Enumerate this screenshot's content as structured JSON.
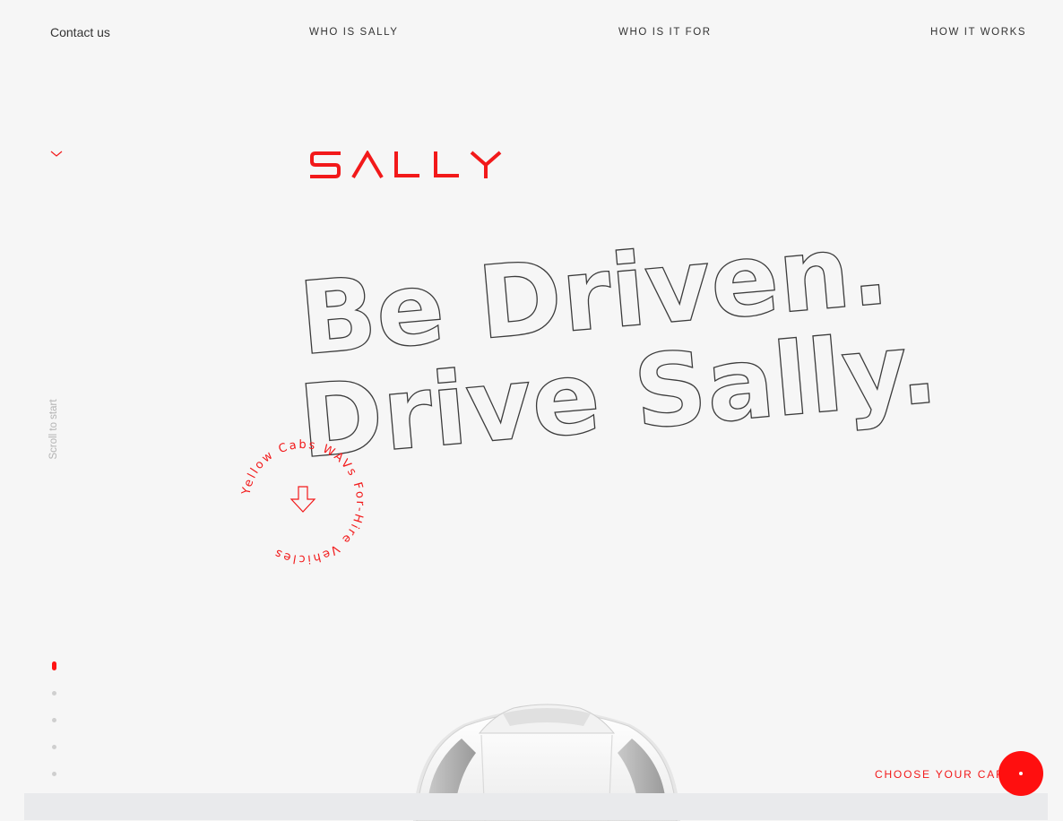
{
  "nav": {
    "contact": "Contact us",
    "items": [
      "WHO IS SALLY",
      "WHO IS IT FOR",
      "HOW IT WORKS"
    ]
  },
  "brand": {
    "logo_text": "SALLY",
    "accent_color": "#f2191a"
  },
  "hero": {
    "line1": "Be Driven.",
    "line2": "Drive Sally."
  },
  "badge": {
    "ring_text": "Yellow Cabs WAVs For-Hire Vehicles",
    "icon": "arrow-down-icon"
  },
  "side": {
    "scroll_label": "Scroll to start",
    "dots_count": 5,
    "active_dot": 1
  },
  "cta": {
    "label": "CHOOSE YOUR CAR",
    "button_color": "#ff0f0f"
  }
}
